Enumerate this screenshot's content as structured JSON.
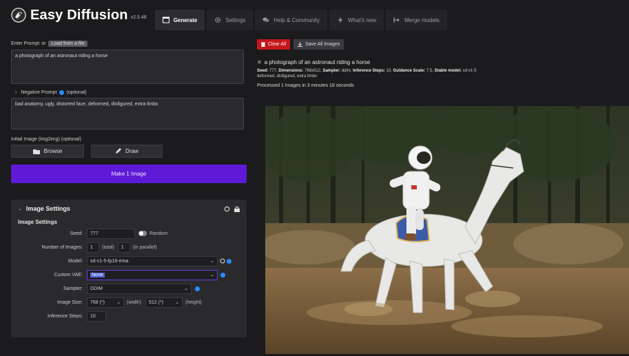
{
  "app": {
    "title": "Easy Diffusion",
    "version": "v2.5.48"
  },
  "tabs": [
    {
      "label": "Generate",
      "icon": "image-icon",
      "active": true
    },
    {
      "label": "Settings",
      "icon": "gear-icon",
      "active": false
    },
    {
      "label": "Help & Community",
      "icon": "comments-icon",
      "active": false
    },
    {
      "label": "What's new",
      "icon": "bolt-icon",
      "active": false
    },
    {
      "label": "Merge models",
      "icon": "merge-icon",
      "active": false
    }
  ],
  "prompt": {
    "label": "Enter Prompt",
    "or": "or",
    "load_button": "Load from a file",
    "value": "a photograph of an astronaut riding a horse"
  },
  "negative_prompt": {
    "label": "Negative Prompt",
    "optional": "(optional)",
    "value": "bad anatomy, ugly, distorted face, deformed, disfigured, extra limbs"
  },
  "init_image": {
    "label": "Initial Image (img2img) (optional)",
    "browse_label": "Browse",
    "draw_label": "Draw"
  },
  "make_button": "Make 1 Image",
  "image_settings": {
    "title": "Image Settings",
    "subtitle": "Image Settings",
    "seed": {
      "label": "Seed:",
      "value": "777",
      "random_label": "Random"
    },
    "num_images": {
      "label": "Number of Images:",
      "total": "1",
      "total_label": "(total)",
      "parallel": "1",
      "parallel_label": "(in parallel)"
    },
    "model": {
      "label": "Model:",
      "value": "sd-v1-5-fp16-ema"
    },
    "vae": {
      "label": "Custom VAE:",
      "value": "None"
    },
    "sampler": {
      "label": "Sampler:",
      "value": "DDIM"
    },
    "image_size": {
      "label": "Image Size:",
      "width": "768 (*)",
      "width_label": "(width)",
      "height": "512 (*)",
      "height_label": "(height)"
    },
    "steps": {
      "label": "Inference Steps:",
      "value": "10"
    }
  },
  "right": {
    "clear_label": "Clear All",
    "save_label": "Save All Images",
    "result_title": "a photograph of an astronaut riding a horse",
    "meta_line1_seed_label": "Seed:",
    "meta_line1_seed": "777,",
    "meta_line1_dim_label": "Dimensions:",
    "meta_line1_dim": "768x512,",
    "meta_line1_sampler_label": "Sampler:",
    "meta_line1_sampler": "ddim,",
    "meta_line1_steps_label": "Inference Steps:",
    "meta_line1_steps": "10,",
    "meta_line1_guidance_label": "Guidance Scale:",
    "meta_line1_guidance": "7.5,",
    "meta_line1_model_label": "Stable model:",
    "meta_line1_model": "sd-v1-5",
    "meta_line2": "deformed, disfigured, extra limbs",
    "processed": "Processed 1 images in 3 minutes 18 seconds"
  },
  "colors": {
    "accent": "#5e1ad6",
    "danger": "#c4171b",
    "link_blue": "#2a8bff"
  }
}
